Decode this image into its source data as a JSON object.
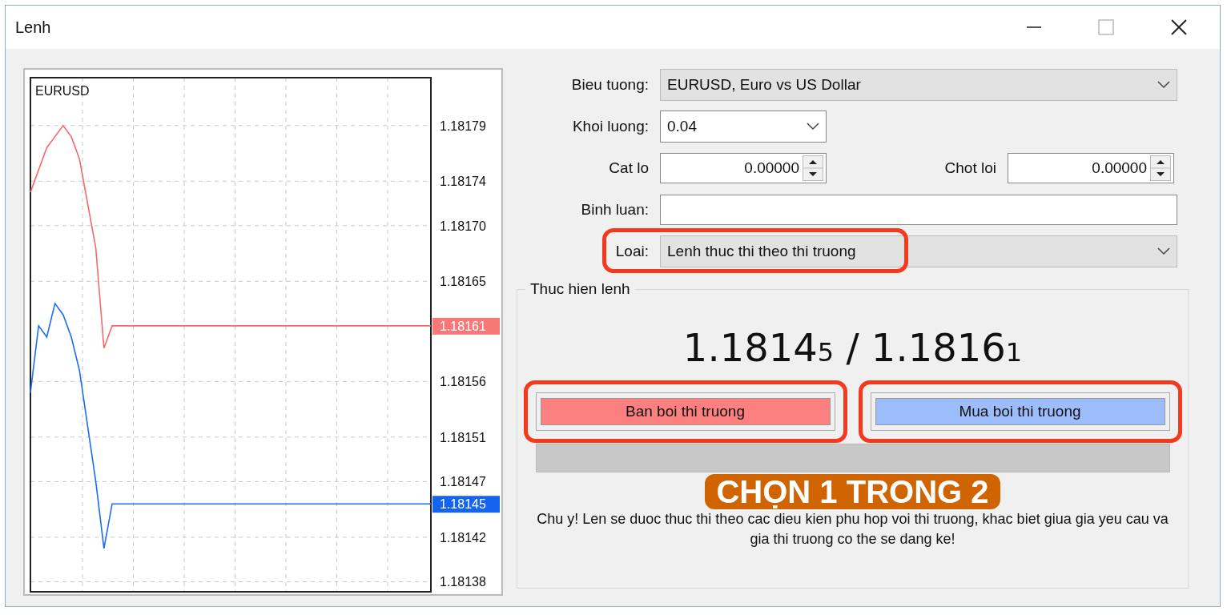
{
  "window": {
    "title": "Lenh"
  },
  "chart": {
    "chart_data": {
      "type": "line",
      "title": "EURUSD",
      "categories": [
        null,
        null,
        null,
        null,
        null,
        null,
        null,
        null,
        null,
        null,
        null,
        null,
        null,
        null,
        null,
        null,
        null,
        null,
        null,
        null,
        null,
        null,
        null,
        null,
        null,
        null,
        null,
        null,
        null,
        null,
        null,
        null,
        null,
        null,
        null,
        null,
        null,
        null,
        null,
        null,
        null,
        null,
        null,
        null,
        null,
        null,
        null,
        null,
        null,
        null
      ],
      "ylim": [
        1.181371,
        1.181833
      ],
      "series": [
        {
          "color": "#f46a6a",
          "values": [
            1.18173,
            1.18175,
            1.18177,
            1.18178,
            1.18179,
            1.18178,
            1.18176,
            1.18172,
            1.18168,
            1.18159,
            1.18161,
            1.18161,
            1.18161,
            1.18161,
            1.18161,
            1.18161,
            1.18161,
            1.18161,
            1.18161,
            1.18161,
            1.18161,
            1.18161,
            1.18161,
            1.18161,
            1.18161,
            1.18161,
            1.18161,
            1.18161,
            1.18161,
            1.18161,
            1.18161,
            1.18161,
            1.18161,
            1.18161,
            1.18161,
            1.18161,
            1.18161,
            1.18161,
            1.18161,
            1.18161,
            1.18161,
            1.18161,
            1.18161,
            1.18161,
            1.18161,
            1.18161,
            1.18161,
            1.18161,
            1.18161,
            1.18161
          ]
        },
        {
          "color": "#1e6cf2",
          "values": [
            1.18155,
            1.18161,
            1.1816,
            1.18163,
            1.18162,
            1.1816,
            1.18157,
            1.18152,
            1.18147,
            1.18141,
            1.18145,
            1.18145,
            1.18145,
            1.18145,
            1.18145,
            1.18145,
            1.18145,
            1.18145,
            1.18145,
            1.18145,
            1.18145,
            1.18145,
            1.18145,
            1.18145,
            1.18145,
            1.18145,
            1.18145,
            1.18145,
            1.18145,
            1.18145,
            1.18145,
            1.18145,
            1.18145,
            1.18145,
            1.18145,
            1.18145,
            1.18145,
            1.18145,
            1.18145,
            1.18145,
            1.18145,
            1.18145,
            1.18145,
            1.18145,
            1.18145,
            1.18145,
            1.18145,
            1.18145,
            1.18145,
            1.18145
          ]
        }
      ],
      "yticks": [
        {
          "value": 1.18179,
          "label": "1.18179"
        },
        {
          "value": 1.18174,
          "label": "1.18174"
        },
        {
          "value": 1.1817,
          "label": "1.18170"
        },
        {
          "value": 1.18165,
          "label": "1.18165"
        },
        {
          "value": 1.18156,
          "label": "1.18156"
        },
        {
          "value": 1.18151,
          "label": "1.18151"
        },
        {
          "value": 1.18147,
          "label": "1.18147"
        },
        {
          "value": 1.18142,
          "label": "1.18142"
        },
        {
          "value": 1.18138,
          "label": "1.18138"
        }
      ],
      "grid": true
    },
    "price_tags": [
      {
        "text": "1.18161",
        "color": "#f87878"
      },
      {
        "text": "1.18145",
        "color": "#1464f0"
      }
    ]
  },
  "form": {
    "symbol": {
      "label": "Bieu tuong:",
      "value": "EURUSD, Euro vs US Dollar"
    },
    "volume": {
      "label": "Khoi luong:",
      "value": "0.04"
    },
    "stop_loss": {
      "label": "Cat lo",
      "value": "0.00000"
    },
    "take_profit": {
      "label": "Chot loi",
      "value": "0.00000"
    },
    "comment": {
      "label": "Binh luan:"
    },
    "type": {
      "label": "Loai:",
      "value": "Lenh thuc thi theo thi truong"
    }
  },
  "execution": {
    "title": "Thuc hien lenh",
    "bid": {
      "main": "1.1814",
      "last_digit": "5"
    },
    "separator": "/",
    "ask": {
      "main": "1.1816",
      "last_digit": "1"
    },
    "progress": {
      "level": 0
    },
    "buttons": [
      {
        "kind": "sell",
        "label": "Ban boi thi truong"
      },
      {
        "kind": "buy",
        "label": "Mua boi thi truong"
      }
    ],
    "note": "Chu y! Len se duoc thuc thi theo cac dieu kien phu hop voi thi truong, khac biet giua gia yeu cau va gia thi truong co the se dang ke!"
  },
  "annotation": {
    "caption": "CHỌN 1 TRONG 2"
  }
}
